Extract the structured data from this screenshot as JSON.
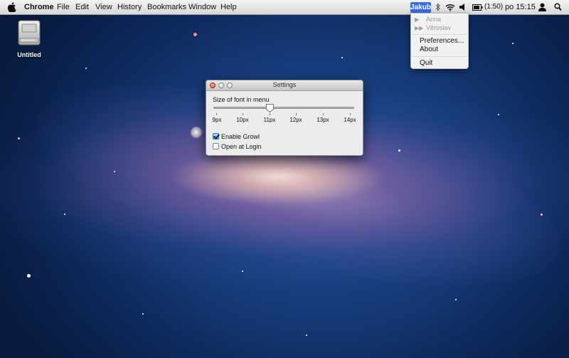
{
  "menubar": {
    "app_name": "Chrome",
    "menus": [
      "File",
      "Edit",
      "View",
      "History",
      "Bookmarks",
      "Window",
      "Help"
    ],
    "status_user": "Jakub",
    "battery_text": "(1:50)",
    "clock": "po 15:15",
    "icons": [
      "apple-icon",
      "bluetooth-icon",
      "wifi-icon",
      "volume-icon",
      "battery-icon",
      "user-icon",
      "spotlight-icon"
    ]
  },
  "desktop": {
    "drive_label": "Untitled"
  },
  "dropdown": {
    "users": [
      {
        "glyph": "▶",
        "name": "Anna"
      },
      {
        "glyph": "▶▶",
        "name": "Věroslav"
      }
    ],
    "preferences": "Preferences...",
    "about": "About",
    "quit": "Quit"
  },
  "settings": {
    "title": "Settings",
    "font_label": "Size of font in menu",
    "slider_options": [
      "9px",
      "10px",
      "11px",
      "12px",
      "13px",
      "14px"
    ],
    "slider_value": "11px",
    "enable_growl": {
      "label": "Enable Growl",
      "checked": true
    },
    "open_at_login": {
      "label": "Open at Login",
      "checked": false
    }
  },
  "colors": {
    "status_user_highlight": "#3b6bdc",
    "desktop_blue": "#163a78"
  }
}
